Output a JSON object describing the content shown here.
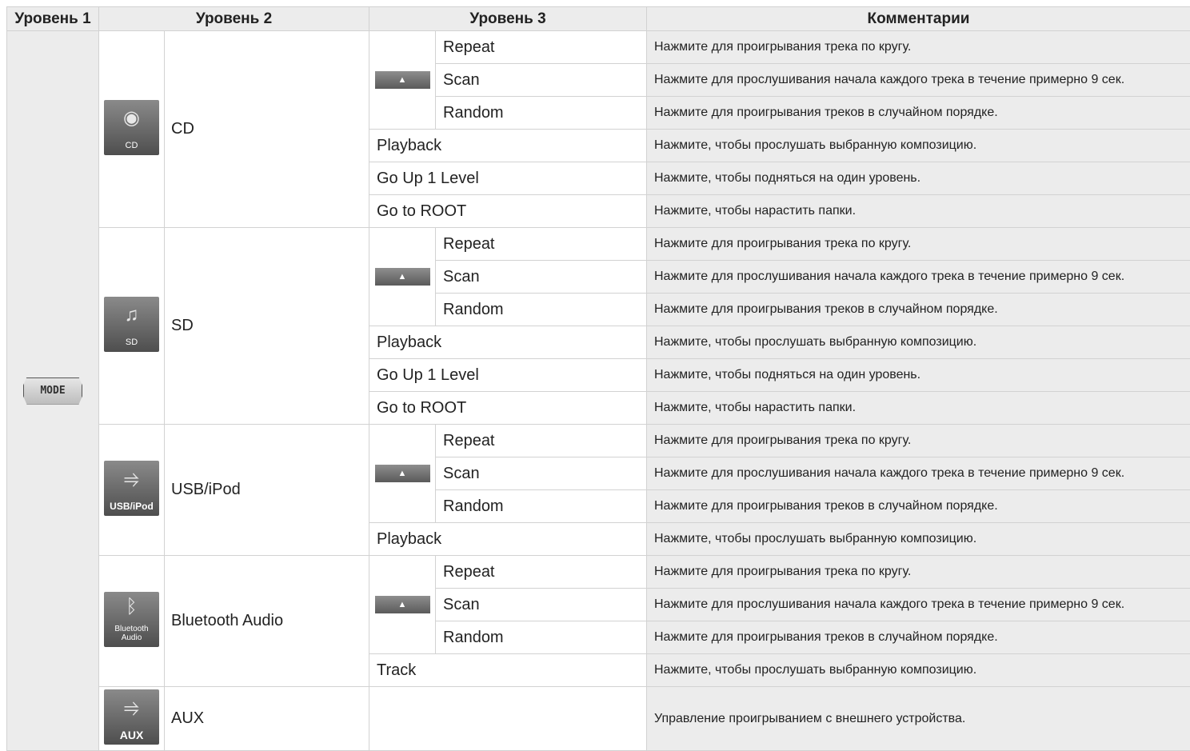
{
  "headers": {
    "level1": "Уровень 1",
    "level2": "Уровень 2",
    "level3": "Уровень 3",
    "comments": "Комментарии"
  },
  "level1_button": "MODE",
  "arrow_icon": "▲",
  "sources": [
    {
      "name": "CD",
      "icon": {
        "semantic": "cd-disc-icon",
        "label": "CD"
      },
      "sub": [
        {
          "label": "Repeat",
          "comment": "Нажмите для проигрывания трека по кругу."
        },
        {
          "label": "Scan",
          "comment": "Нажмите для прослушивания начала каждого трека в течение примерно 9 сек."
        },
        {
          "label": "Random",
          "comment": "Нажмите для проигрывания треков в случайном порядке."
        }
      ],
      "items": [
        {
          "label": "Playback",
          "comment": "Нажмите, чтобы прослушать выбранную композицию."
        },
        {
          "label": "Go Up 1 Level",
          "comment": "Нажмите, чтобы подняться на один уровень."
        },
        {
          "label": "Go to ROOT",
          "comment": "Нажмите, чтобы нарастить папки."
        }
      ]
    },
    {
      "name": "SD",
      "icon": {
        "semantic": "sd-card-music-icon",
        "label": "SD"
      },
      "sub": [
        {
          "label": "Repeat",
          "comment": "Нажмите для проигрывания трека по кругу."
        },
        {
          "label": "Scan",
          "comment": "Нажмите для прослушивания начала каждого трека в течение примерно 9 сек."
        },
        {
          "label": "Random",
          "comment": "Нажмите для проигрывания треков в случайном порядке."
        }
      ],
      "items": [
        {
          "label": "Playback",
          "comment": "Нажмите, чтобы прослушать выбранную композицию."
        },
        {
          "label": "Go Up 1 Level",
          "comment": "Нажмите, чтобы подняться на один уровень."
        },
        {
          "label": "Go to ROOT",
          "comment": "Нажмите, чтобы нарастить папки."
        }
      ]
    },
    {
      "name": "USB/iPod",
      "icon": {
        "semantic": "usb-cable-icon",
        "label": "USB/iPod"
      },
      "sub": [
        {
          "label": "Repeat",
          "comment": "Нажмите для проигрывания трека по кругу."
        },
        {
          "label": "Scan",
          "comment": "Нажмите для прослушивания начала каждого трека в течение примерно 9 сек."
        },
        {
          "label": "Random",
          "comment": "Нажмите для проигрывания треков в случайном порядке."
        }
      ],
      "items": [
        {
          "label": "Playback",
          "comment": "Нажмите, чтобы прослушать выбранную композицию."
        }
      ]
    },
    {
      "name": "Bluetooth Audio",
      "icon": {
        "semantic": "bluetooth-icon",
        "label_line1": "Bluetooth",
        "label_line2": "Audio"
      },
      "sub": [
        {
          "label": "Repeat",
          "comment": "Нажмите для проигрывания трека по кругу."
        },
        {
          "label": "Scan",
          "comment": "Нажмите для прослушивания начала каждого трека в течение примерно 9 сек."
        },
        {
          "label": "Random",
          "comment": "Нажмите для проигрывания треков в случайном порядке."
        }
      ],
      "items": [
        {
          "label": "Track",
          "comment": "Нажмите, чтобы прослушать выбранную композицию."
        }
      ]
    },
    {
      "name": "AUX",
      "icon": {
        "semantic": "aux-cable-icon",
        "label": "AUX"
      },
      "comment": "Управление проигрыванием с внешнего устройства."
    }
  ]
}
